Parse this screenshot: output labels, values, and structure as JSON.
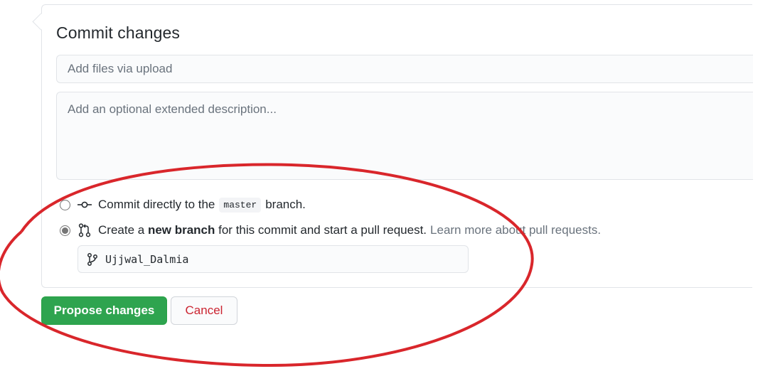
{
  "commit": {
    "title": "Commit changes",
    "summary_placeholder": "Add files via upload",
    "description_placeholder": "Add an optional extended description..."
  },
  "options": {
    "direct": {
      "text_before": "Commit directly to the",
      "branch_code": "master",
      "text_after": "branch.",
      "icon": "git-commit-icon",
      "checked": false
    },
    "new_branch": {
      "text_prefix": "Create a ",
      "bold_text": "new branch",
      "text_suffix": " for this commit and start a pull request.",
      "link_text": "Learn more about pull requests.",
      "icon": "git-pull-request-icon",
      "checked": true
    }
  },
  "branch_field": {
    "value": "Ujjwal_Dalmia",
    "icon": "git-branch-icon"
  },
  "buttons": {
    "propose": "Propose changes",
    "cancel": "Cancel"
  },
  "colors": {
    "primary_green": "#2ea44f",
    "cancel_red": "#cb2431",
    "annotation_red": "#d9262b",
    "muted_text": "#6a737d"
  }
}
